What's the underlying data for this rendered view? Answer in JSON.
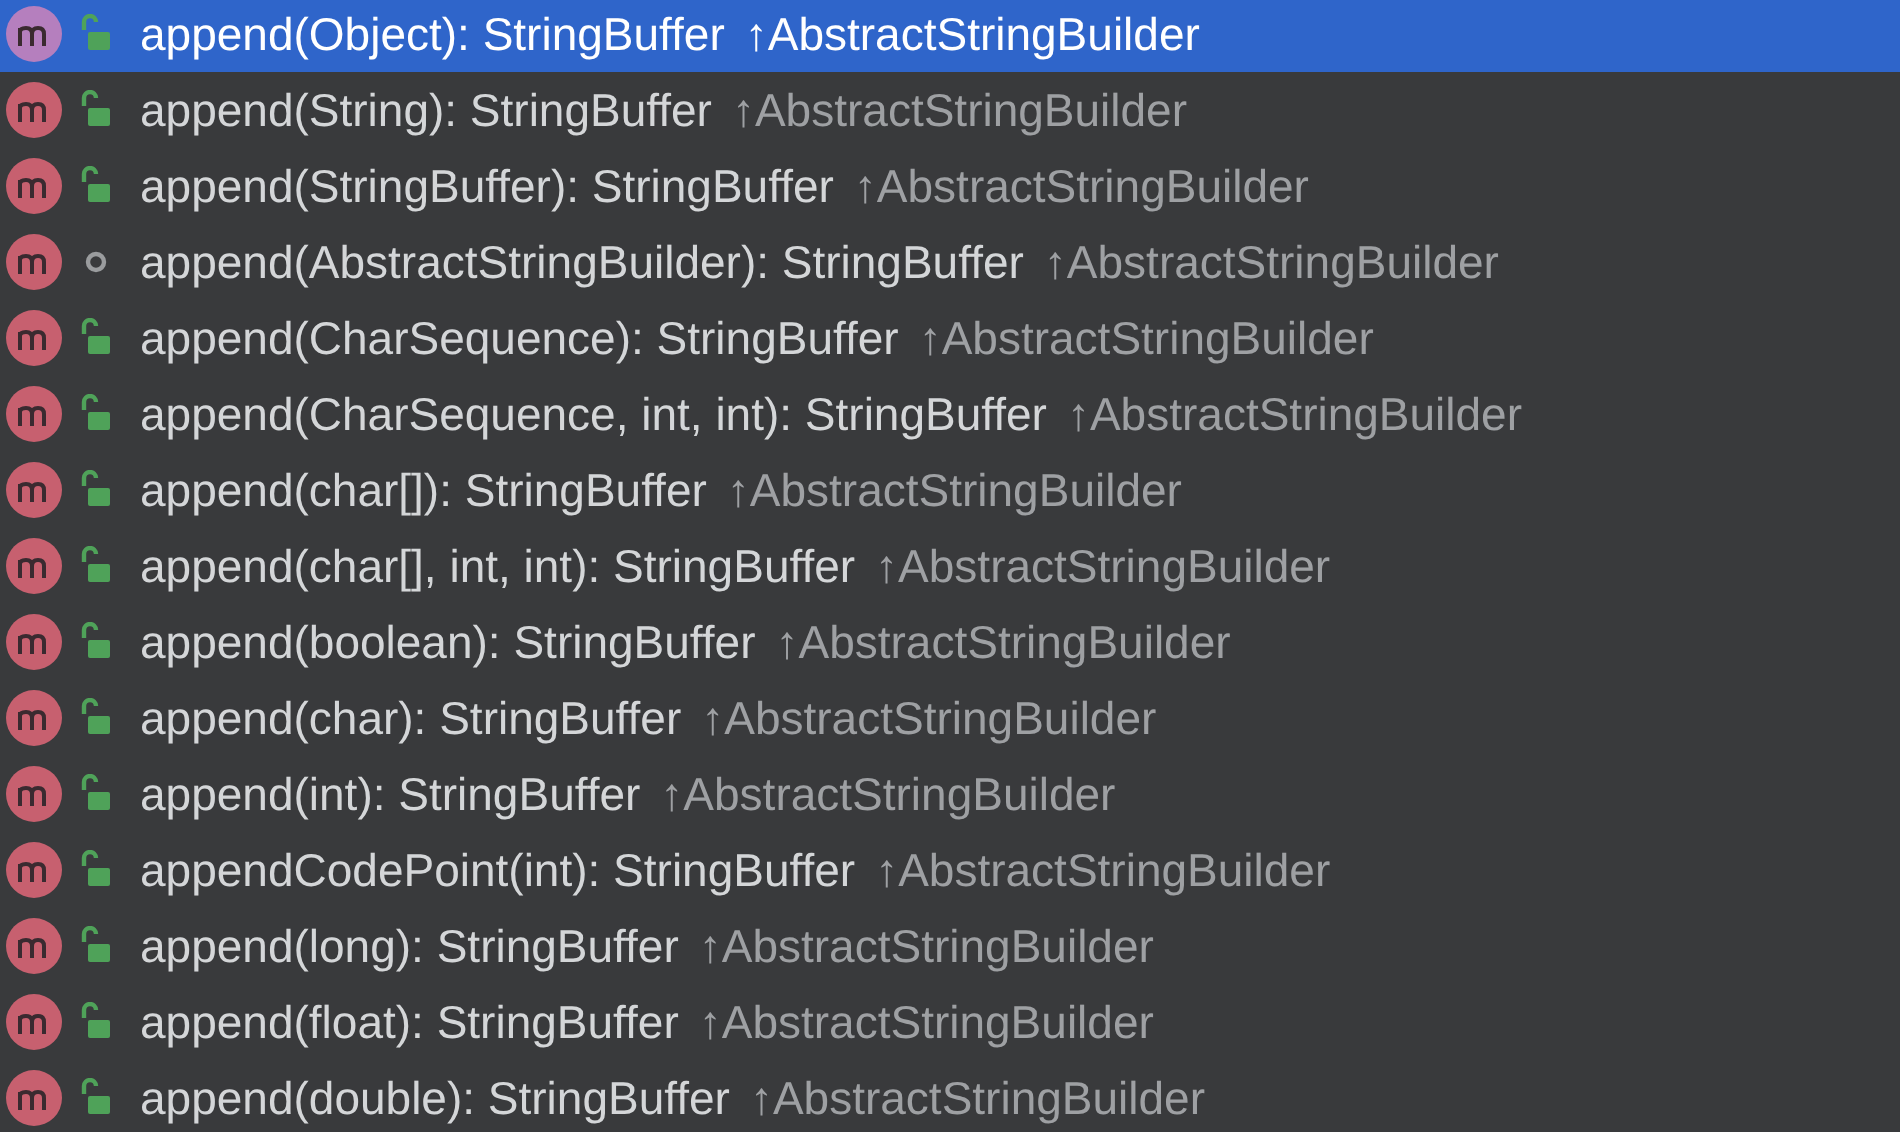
{
  "completion_list": [
    {
      "kind": "public",
      "selected": true,
      "signature": "append(Object): StringBuffer",
      "origin": "↑AbstractStringBuilder"
    },
    {
      "kind": "public",
      "selected": false,
      "signature": "append(String): StringBuffer",
      "origin": "↑AbstractStringBuilder"
    },
    {
      "kind": "public",
      "selected": false,
      "signature": "append(StringBuffer): StringBuffer",
      "origin": "↑AbstractStringBuilder"
    },
    {
      "kind": "package",
      "selected": false,
      "signature": "append(AbstractStringBuilder): StringBuffer",
      "origin": "↑AbstractStringBuilder"
    },
    {
      "kind": "public",
      "selected": false,
      "signature": "append(CharSequence): StringBuffer",
      "origin": "↑AbstractStringBuilder"
    },
    {
      "kind": "public",
      "selected": false,
      "signature": "append(CharSequence, int, int): StringBuffer",
      "origin": "↑AbstractStringBuilder"
    },
    {
      "kind": "public",
      "selected": false,
      "signature": "append(char[]): StringBuffer",
      "origin": "↑AbstractStringBuilder"
    },
    {
      "kind": "public",
      "selected": false,
      "signature": "append(char[], int, int): StringBuffer",
      "origin": "↑AbstractStringBuilder"
    },
    {
      "kind": "public",
      "selected": false,
      "signature": "append(boolean): StringBuffer",
      "origin": "↑AbstractStringBuilder"
    },
    {
      "kind": "public",
      "selected": false,
      "signature": "append(char): StringBuffer",
      "origin": "↑AbstractStringBuilder"
    },
    {
      "kind": "public",
      "selected": false,
      "signature": "append(int): StringBuffer",
      "origin": "↑AbstractStringBuilder"
    },
    {
      "kind": "public",
      "selected": false,
      "signature": "appendCodePoint(int): StringBuffer",
      "origin": "↑AbstractStringBuilder"
    },
    {
      "kind": "public",
      "selected": false,
      "signature": "append(long): StringBuffer",
      "origin": "↑AbstractStringBuilder"
    },
    {
      "kind": "public",
      "selected": false,
      "signature": "append(float): StringBuffer",
      "origin": "↑AbstractStringBuilder"
    },
    {
      "kind": "public",
      "selected": false,
      "signature": "append(double): StringBuffer",
      "origin": "↑AbstractStringBuilder"
    }
  ]
}
